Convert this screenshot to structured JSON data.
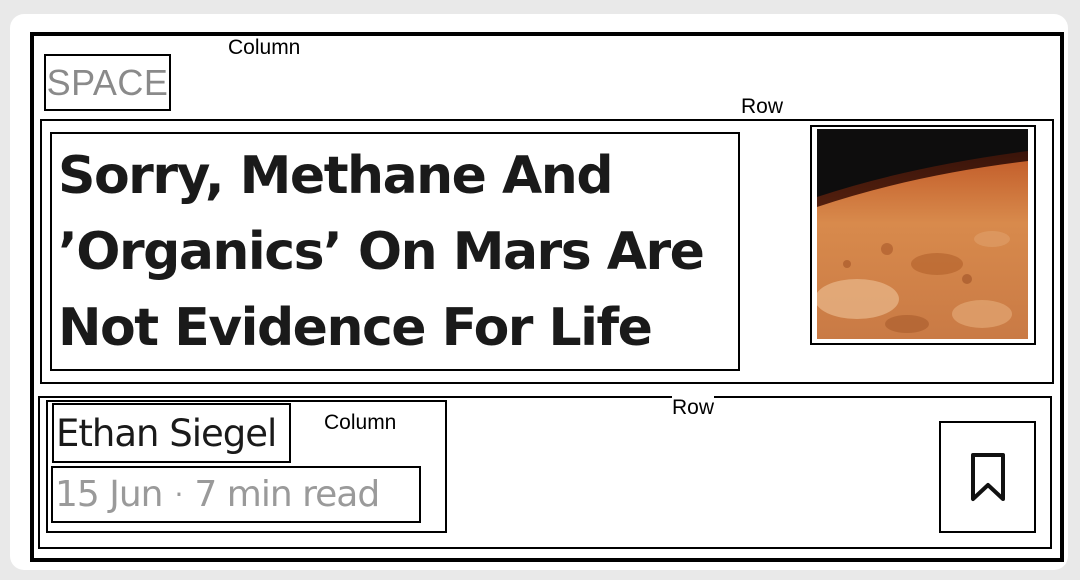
{
  "annotations": {
    "outer_column_label": "Column",
    "row1_label": "Row",
    "row2_label": "Row",
    "inner_column_label": "Column"
  },
  "article": {
    "category": "SPACE",
    "title": "Sorry, Methane And ’Organics’ On Mars Are Not Evidence For Life",
    "thumbnail_icon": "mars-surface-image",
    "author": "Ethan Siegel",
    "date": "15 Jun",
    "separator": "·",
    "read_time": "7 min read",
    "bookmark_icon": "bookmark-icon"
  }
}
